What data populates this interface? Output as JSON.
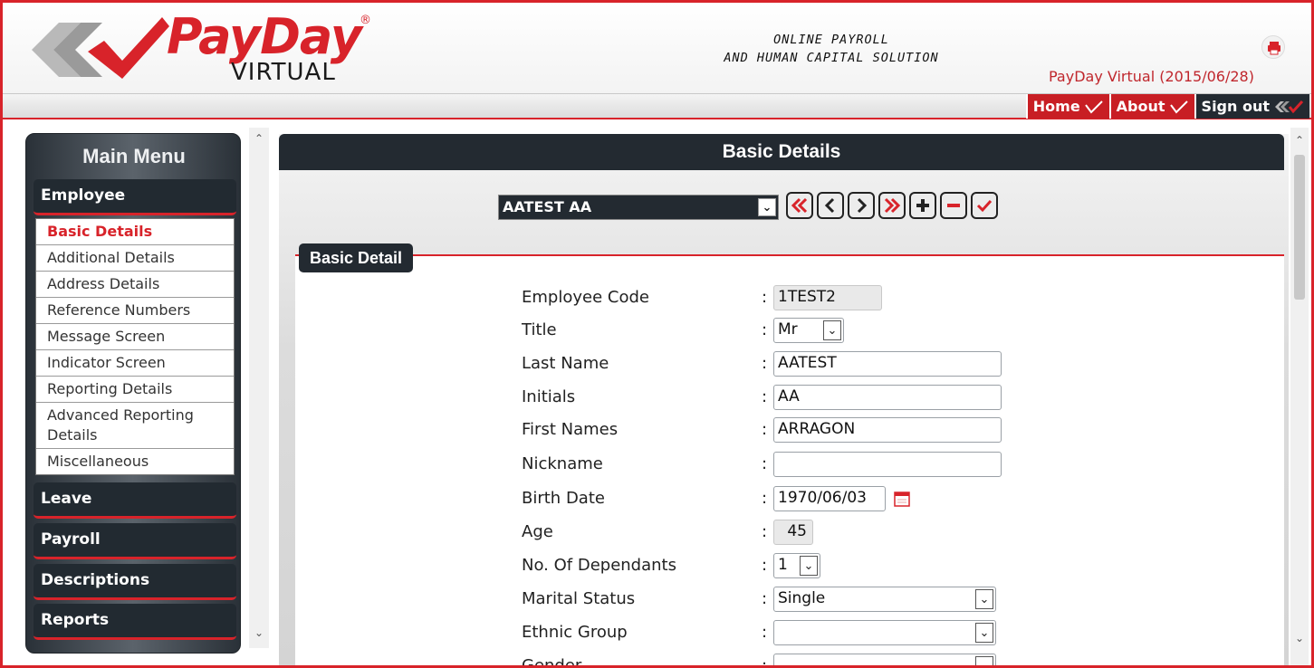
{
  "header": {
    "logo_text": "PayDay",
    "logo_registered": "®",
    "logo_sub": "VIRTUAL",
    "tagline_line1": "ONLINE PAYROLL",
    "tagline_line2": "AND HUMAN CAPITAL SOLUTION",
    "company_date": "PayDay Virtual (2015/06/28)",
    "print_icon": "printer-icon"
  },
  "nav": {
    "home": "Home",
    "about": "About",
    "sign_out": "Sign out"
  },
  "sidebar": {
    "title": "Main Menu",
    "sections": [
      "Employee",
      "Leave",
      "Payroll",
      "Descriptions",
      "Reports"
    ],
    "employee_items": [
      "Basic Details",
      "Additional Details",
      "Address Details",
      "Reference Numbers",
      "Message Screen",
      "Indicator Screen",
      "Reporting Details",
      "Advanced Reporting Details",
      "Miscellaneous"
    ],
    "active_item": "Basic Details"
  },
  "main": {
    "title": "Basic Details",
    "employee_selected": "AATEST AA",
    "toolbar_icons": [
      "first-record-icon",
      "previous-record-icon",
      "next-record-icon",
      "last-record-icon",
      "add-record-icon",
      "delete-record-icon",
      "save-record-icon"
    ],
    "section_tab": "Basic Detail"
  },
  "form": {
    "employee_code": {
      "label": "Employee Code",
      "value": "1TEST2"
    },
    "title": {
      "label": "Title",
      "value": "Mr"
    },
    "last_name": {
      "label": "Last Name",
      "value": "AATEST"
    },
    "initials": {
      "label": "Initials",
      "value": "AA"
    },
    "first_names": {
      "label": "First Names",
      "value": "ARRAGON"
    },
    "nickname": {
      "label": "Nickname",
      "value": ""
    },
    "birth_date": {
      "label": "Birth Date",
      "value": "1970/06/03"
    },
    "age": {
      "label": "Age",
      "value": "45"
    },
    "dependants": {
      "label": "No. Of Dependants",
      "value": "1"
    },
    "marital_status": {
      "label": "Marital Status",
      "value": "Single"
    },
    "ethnic_group": {
      "label": "Ethnic Group",
      "value": ""
    },
    "gender": {
      "label": "Gender",
      "value": ""
    }
  },
  "colors": {
    "brand_red": "#d8232a",
    "dark_panel": "#232a31"
  }
}
